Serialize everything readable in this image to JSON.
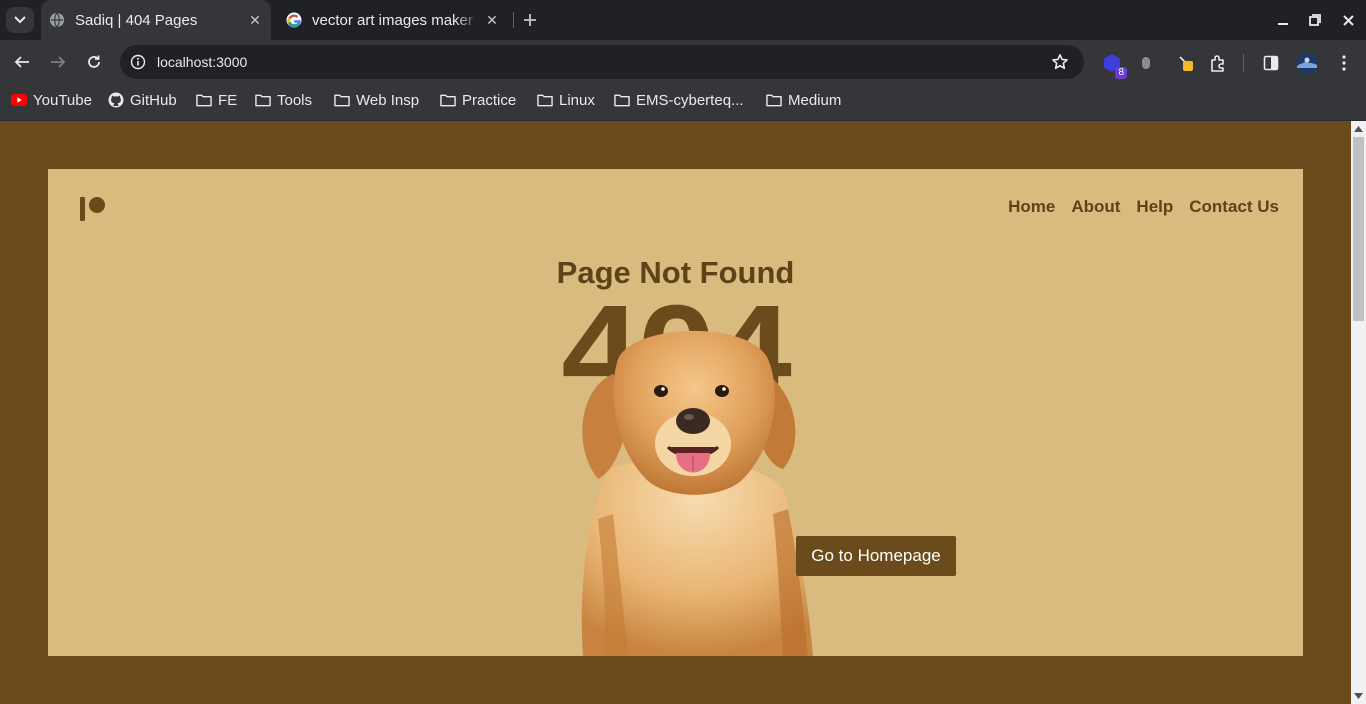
{
  "browser": {
    "tabs": [
      {
        "title": "Sadiq | 404 Pages",
        "active": true,
        "favicon": "globe-icon"
      },
      {
        "title": "vector art images maker",
        "active": false,
        "favicon": "google-icon"
      }
    ],
    "url": "localhost:3000",
    "bookmarks": [
      {
        "label": "YouTube",
        "icon": "youtube-icon"
      },
      {
        "label": "GitHub",
        "icon": "github-icon"
      },
      {
        "label": "FE",
        "icon": "folder-icon"
      },
      {
        "label": "Tools",
        "icon": "folder-icon"
      },
      {
        "label": "Web Insp",
        "icon": "folder-icon"
      },
      {
        "label": "Practice",
        "icon": "folder-icon"
      },
      {
        "label": "Linux",
        "icon": "folder-icon"
      },
      {
        "label": "EMS-cyberteq...",
        "icon": "folder-icon"
      },
      {
        "label": "Medium",
        "icon": "folder-icon"
      }
    ],
    "extension_badge": "8"
  },
  "page": {
    "nav": [
      "Home",
      "About",
      "Help",
      "Contact Us"
    ],
    "title": "Page Not Found",
    "code": "404",
    "button_label": "Go to Homepage",
    "illustration": "golden-retriever-dog"
  },
  "colors": {
    "background": "#6b4b1b",
    "card": "#d9bb7f",
    "text": "#5e4319",
    "button": "#6b4b1b"
  }
}
